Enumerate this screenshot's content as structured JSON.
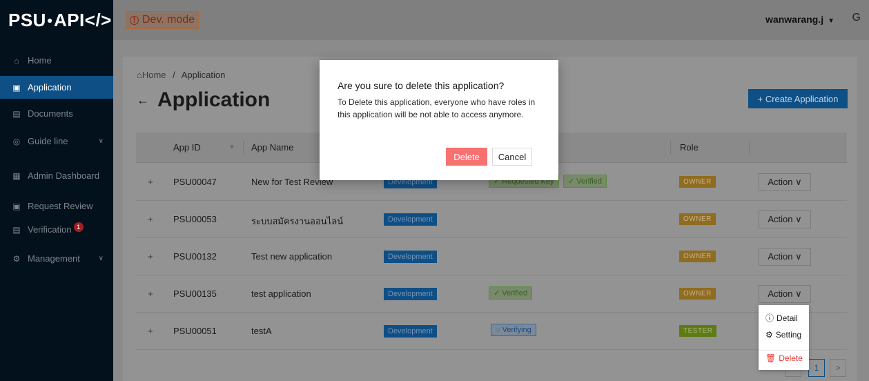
{
  "brand": {
    "logo_text": "PSU",
    "logo_suffix": "API</>"
  },
  "header": {
    "dev_mode": "Dev. mode",
    "username": "wanwarang.j",
    "logout_icon": "G"
  },
  "sidebar": {
    "items": [
      {
        "label": "Home",
        "icon": "⌂"
      },
      {
        "label": "Application",
        "icon": "▣"
      },
      {
        "label": "Documents",
        "icon": "▤"
      },
      {
        "label": "Guide line",
        "icon": "◎"
      },
      {
        "label": "Admin Dashboard",
        "icon": "▦"
      },
      {
        "label": "Request Review",
        "icon": "▣"
      },
      {
        "label": "Verification",
        "icon": "▤",
        "badge": "1"
      },
      {
        "label": "Management",
        "icon": "⚙"
      }
    ]
  },
  "breadcrumb": {
    "home": "Home",
    "sep": "/",
    "current": "Application"
  },
  "page": {
    "title": "Application",
    "create_button": "+ Create Application"
  },
  "table": {
    "headers": {
      "app_id": "App ID",
      "app_name": "App Name",
      "role": "Role"
    },
    "rows": [
      {
        "app_id": "PSU00047",
        "app_name": "New for Test Review",
        "env": "Development",
        "status1": "✓ Requested Key",
        "status2": "✓ Verified",
        "role": "OWNER",
        "action": "Action ∨"
      },
      {
        "app_id": "PSU00053",
        "app_name": "ระบบสมัครงานออนไลน์",
        "env": "Development",
        "role": "OWNER",
        "action": "Action ∨"
      },
      {
        "app_id": "PSU00132",
        "app_name": "Test new application",
        "env": "Development",
        "role": "OWNER",
        "action": "Action ∨"
      },
      {
        "app_id": "PSU00135",
        "app_name": "test application",
        "env": "Development",
        "status1": "✓ Verified",
        "role": "OWNER",
        "action": "Action ∨"
      },
      {
        "app_id": "PSU00051",
        "app_name": "testA",
        "env": "Development",
        "status1": "◌ Verifying",
        "role": "TESTER",
        "action": "Action ∨"
      }
    ]
  },
  "dropdown": {
    "detail": "Detail",
    "setting": "Setting",
    "delete": "Delete"
  },
  "pagination": {
    "current": "1",
    "next": ">"
  },
  "modal": {
    "title": "Are you sure to delete this application?",
    "message": "To Delete this application, everyone who have roles in this application will be not able to access anymore.",
    "delete_button": "Delete",
    "cancel_button": "Cancel"
  }
}
